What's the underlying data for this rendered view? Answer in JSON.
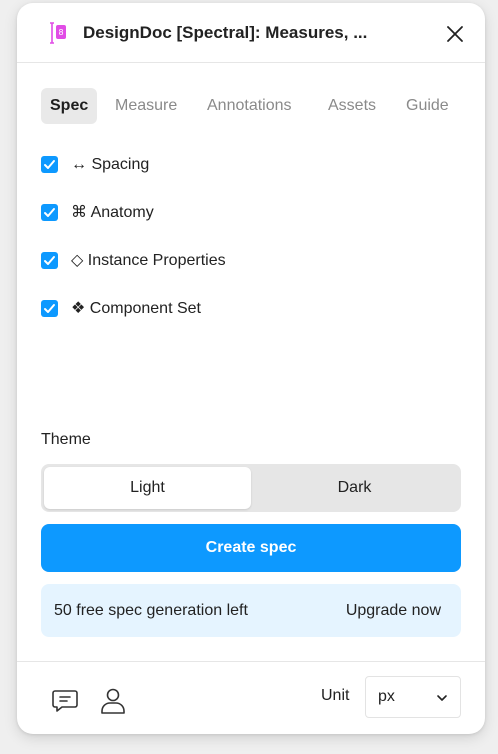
{
  "header": {
    "title": "DesignDoc [Spectral]: Measures, ...",
    "icon": "plugin-icon",
    "close_icon": "close-icon"
  },
  "tabs": [
    {
      "label": "Spec",
      "active": true
    },
    {
      "label": "Measure",
      "active": false
    },
    {
      "label": "Annotations",
      "active": false
    },
    {
      "label": "Assets",
      "active": false
    },
    {
      "label": "Guide",
      "active": false
    }
  ],
  "options": [
    {
      "label": "↔ Spacing",
      "checked": true
    },
    {
      "label": "⌘ Anatomy",
      "checked": true
    },
    {
      "label": "◇ Instance Properties",
      "checked": true
    },
    {
      "label": "❖ Component Set",
      "checked": true
    }
  ],
  "theme": {
    "label": "Theme",
    "options": [
      "Light",
      "Dark"
    ],
    "selected": "Light"
  },
  "create_button": {
    "label": "Create spec"
  },
  "notice": {
    "text": "50 free spec generation left",
    "link": "Upgrade now"
  },
  "footer": {
    "feedback_icon": "chat-icon",
    "account_icon": "user-icon",
    "unit_label": "Unit",
    "unit_value": "px"
  },
  "colors": {
    "accent": "#0d99ff",
    "notice_bg": "#e5f4ff",
    "tab_active_bg": "#e9e9e9"
  }
}
